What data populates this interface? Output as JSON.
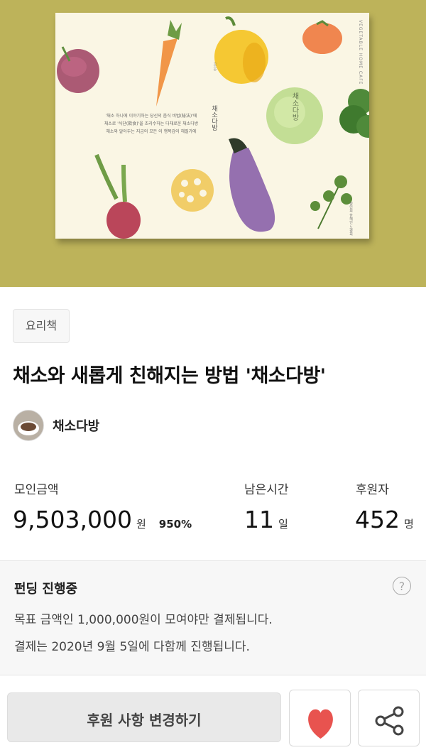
{
  "project": {
    "category": "요리책",
    "title": "채소와 새롭게 친해지는 방법 '채소다방'",
    "creator": "채소다방"
  },
  "cover": {
    "spine_title": "채소다방",
    "brand_vertical": "VEGETABLE HOME CAFE",
    "description_lines": [
      "'채소 하나에 이야기하는 당신의 음식 비법(秘法)'에",
      "채소로 '식단(飮食)'을 조리수하는 다채로운 채소다방",
      "채소와 알아두는 지금의 모든 이 행복감이 해질가에"
    ],
    "authors": [
      "정민희",
      "한혜인",
      "노경희"
    ]
  },
  "stats": {
    "raised": {
      "label": "모인금액",
      "value": "9,503,000",
      "unit": "원",
      "percent": "950%"
    },
    "remaining": {
      "label": "남은시간",
      "value": "11",
      "unit": "일"
    },
    "backers": {
      "label": "후원자",
      "value": "452",
      "unit": "명"
    }
  },
  "funding": {
    "title": "펀딩 진행중",
    "help_symbol": "?",
    "note1": "목표 금액인 1,000,000원이 모여야만 결제됩니다.",
    "note2": "결제는 2020년 9월 5일에 다함께 진행됩니다."
  },
  "actions": {
    "change_label": "후원 사항 변경하기",
    "heart_icon": "heart-icon",
    "share_icon": "share-icon"
  },
  "colors": {
    "hero_background": "#bdb35a",
    "heart": "#e8534f"
  }
}
